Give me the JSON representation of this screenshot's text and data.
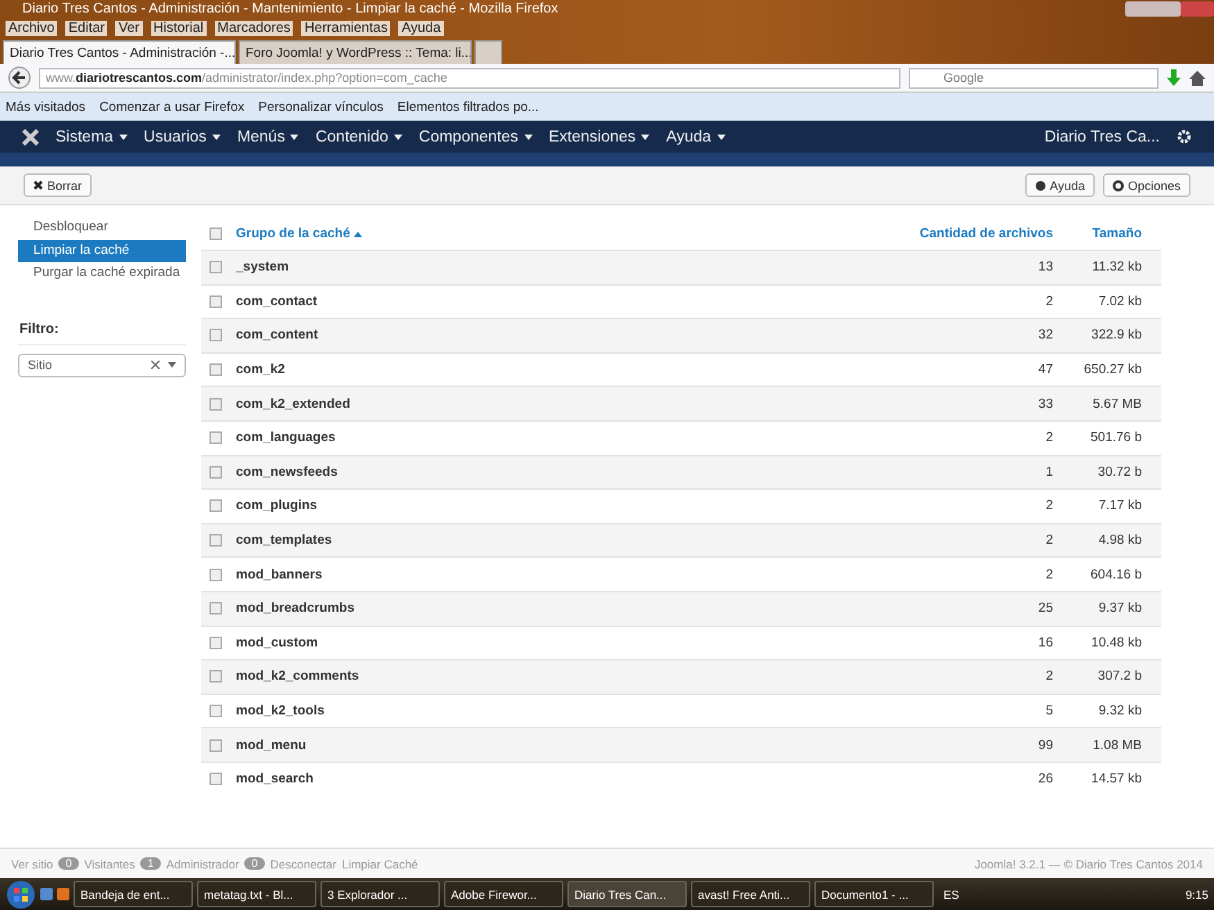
{
  "window": {
    "title": "Diario Tres Cantos - Administración - Mantenimiento - Limpiar la caché - Mozilla Firefox"
  },
  "menu_bar": [
    "Archivo",
    "Editar",
    "Ver",
    "Historial",
    "Marcadores",
    "Herramientas",
    "Ayuda"
  ],
  "browser_tabs": [
    {
      "label": "Diario Tres Cantos - Administración -...",
      "selected": true
    },
    {
      "label": "Foro Joomla! y WordPress :: Tema: li...",
      "selected": false
    }
  ],
  "address": {
    "host": "www.",
    "domain": "diariotrescantos.com",
    "path": "/administrator/index.php?option=com_cache"
  },
  "search": {
    "placeholder": "Google"
  },
  "bookmarks": [
    "Más visitados",
    "Comenzar a usar Firefox",
    "Personalizar vínculos",
    "Elementos filtrados po..."
  ],
  "nav": {
    "items": [
      "Sistema",
      "Usuarios",
      "Menús",
      "Contenido",
      "Componentes",
      "Extensiones",
      "Ayuda"
    ],
    "site": "Diario Tres Ca..."
  },
  "toolbar": {
    "left": [
      "Borrar"
    ],
    "right": [
      "Ayuda",
      "Opciones"
    ]
  },
  "sidebar": {
    "items": [
      {
        "label": "Desbloquear",
        "selected": false
      },
      {
        "label": "Limpiar la caché",
        "selected": true
      },
      {
        "label": "Purgar la caché expirada",
        "selected": false
      }
    ],
    "filter_label": "Filtro:",
    "filter_value": "Sitio"
  },
  "table": {
    "columns": [
      "Grupo de la caché",
      "Cantidad de archivos",
      "Tamaño"
    ],
    "all_checked": false,
    "rows": [
      {
        "group": "_system",
        "count": "13",
        "size": "11.32 kb",
        "checked": false
      },
      {
        "group": "com_contact",
        "count": "2",
        "size": "7.02 kb",
        "checked": false
      },
      {
        "group": "com_content",
        "count": "32",
        "size": "322.9 kb",
        "checked": false
      },
      {
        "group": "com_k2",
        "count": "47",
        "size": "650.27 kb",
        "checked": false
      },
      {
        "group": "com_k2_extended",
        "count": "33",
        "size": "5.67 MB",
        "checked": false
      },
      {
        "group": "com_languages",
        "count": "2",
        "size": "501.76 b",
        "checked": false
      },
      {
        "group": "com_newsfeeds",
        "count": "1",
        "size": "30.72 b",
        "checked": false
      },
      {
        "group": "com_plugins",
        "count": "2",
        "size": "7.17 kb",
        "checked": false
      },
      {
        "group": "com_templates",
        "count": "2",
        "size": "4.98 kb",
        "checked": false
      },
      {
        "group": "mod_banners",
        "count": "2",
        "size": "604.16 b",
        "checked": false
      },
      {
        "group": "mod_breadcrumbs",
        "count": "25",
        "size": "9.37 kb",
        "checked": false
      },
      {
        "group": "mod_custom",
        "count": "16",
        "size": "10.48 kb",
        "checked": false
      },
      {
        "group": "mod_k2_comments",
        "count": "2",
        "size": "307.2 b",
        "checked": false
      },
      {
        "group": "mod_k2_tools",
        "count": "5",
        "size": "9.32 kb",
        "checked": false
      },
      {
        "group": "mod_menu",
        "count": "99",
        "size": "1.08 MB",
        "checked": false
      },
      {
        "group": "mod_search",
        "count": "26",
        "size": "14.57 kb",
        "checked": false
      }
    ]
  },
  "status": {
    "items": [
      {
        "kind": "link",
        "label": "Ver sitio"
      },
      {
        "kind": "badge",
        "label": "0"
      },
      {
        "kind": "text",
        "label": "Visitantes"
      },
      {
        "kind": "badge",
        "label": "1"
      },
      {
        "kind": "text",
        "label": "Administrador"
      },
      {
        "kind": "badge",
        "label": "0"
      },
      {
        "kind": "link",
        "label": "Desconectar"
      },
      {
        "kind": "link",
        "label": "Limpiar Caché"
      }
    ],
    "copyright": "Joomla! 3.2.1 — © Diario Tres Cantos 2014"
  },
  "taskbar": {
    "items": [
      {
        "label": "Bandeja de ent...",
        "selected": false
      },
      {
        "label": "metatag.txt - Bl...",
        "selected": false
      },
      {
        "label": "3 Explorador ...",
        "selected": false
      },
      {
        "label": "Adobe Firewor...",
        "selected": false
      },
      {
        "label": "Diario Tres Can...",
        "selected": true
      },
      {
        "label": "avast! Free Anti...",
        "selected": false
      },
      {
        "label": "Documento1 - ...",
        "selected": false
      }
    ],
    "language": "ES",
    "clock": "9:15"
  }
}
